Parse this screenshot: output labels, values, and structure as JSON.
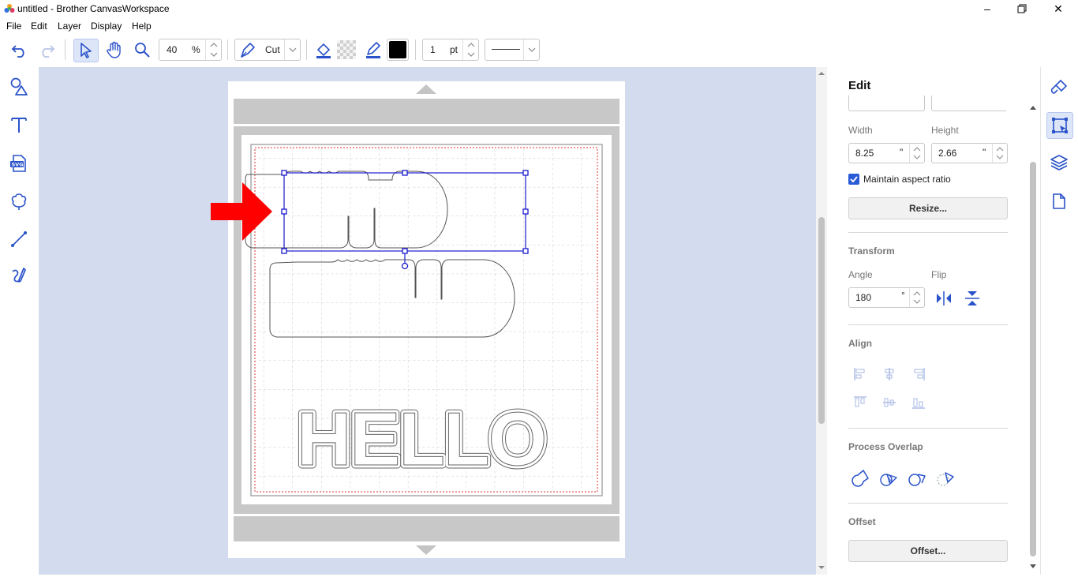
{
  "window": {
    "title": "untitled - Brother CanvasWorkspace"
  },
  "menu": [
    "File",
    "Edit",
    "Layer",
    "Display",
    "Help"
  ],
  "toolbar": {
    "zoom_value": "40",
    "zoom_unit": "%",
    "mode_label": "Cut",
    "line_width_value": "1",
    "line_width_unit": "pt"
  },
  "canvas": {
    "text_content": "HELLO"
  },
  "panel": {
    "title": "Edit",
    "width_label": "Width",
    "height_label": "Height",
    "width_value": "8.25",
    "height_value": "2.66",
    "size_unit": "\"",
    "maintain_aspect_label": "Maintain aspect ratio",
    "maintain_aspect_checked": true,
    "resize_button": "Resize...",
    "transform_title": "Transform",
    "angle_label": "Angle",
    "flip_label": "Flip",
    "angle_value": "180",
    "angle_unit": "°",
    "align_title": "Align",
    "process_overlap_title": "Process Overlap",
    "offset_title": "Offset",
    "offset_button": "Offset..."
  },
  "colors": {
    "accent": "#1f4fd6",
    "canvas_bg": "#d3dcef",
    "fill_color": "#000000",
    "arrow": "#ff0000",
    "selection": "#1a1ad0"
  }
}
